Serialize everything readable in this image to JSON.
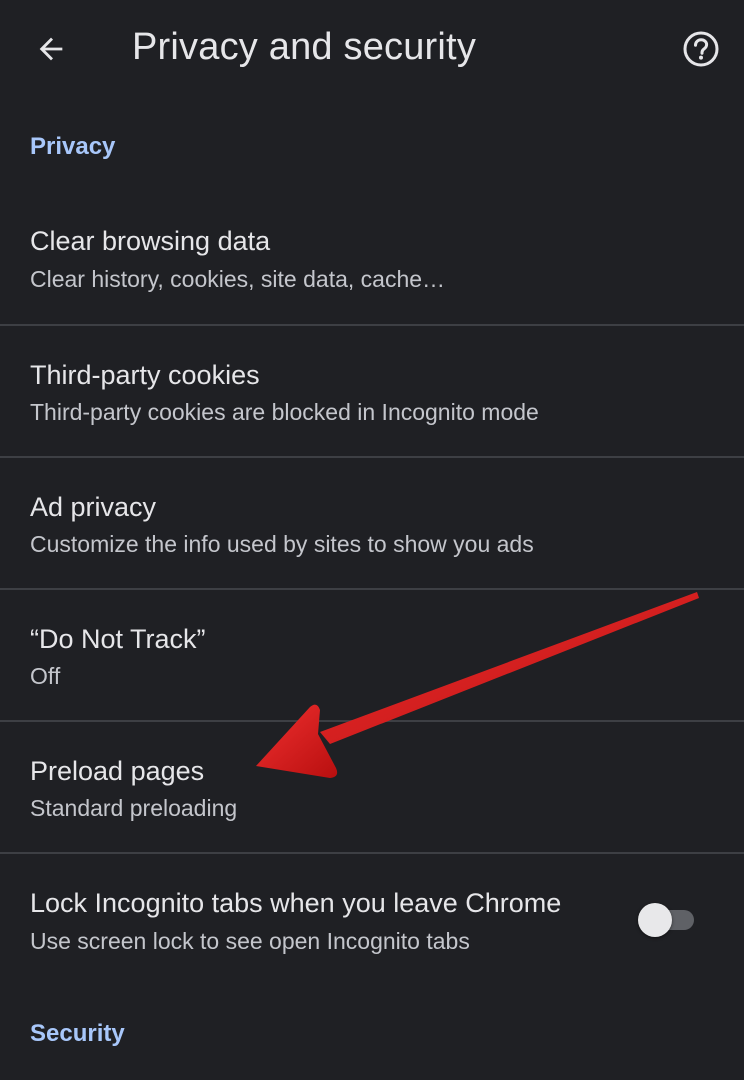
{
  "toolbar": {
    "title": "Privacy and security",
    "back_icon": "arrow-back-icon",
    "help_icon": "help-circle-icon"
  },
  "sections": {
    "privacy_label": "Privacy",
    "security_label": "Security"
  },
  "rows": [
    {
      "title": "Clear browsing data",
      "subtitle": "Clear history, cookies, site data, cache…"
    },
    {
      "title": "Third-party cookies",
      "subtitle": "Third-party cookies are blocked in Incognito mode"
    },
    {
      "title": "Ad privacy",
      "subtitle": "Customize the info used by sites to show you ads"
    },
    {
      "title": "“Do Not Track”",
      "subtitle": "Off"
    },
    {
      "title": "Preload pages",
      "subtitle": "Standard preloading"
    },
    {
      "title": "Lock Incognito tabs when you leave Chrome",
      "subtitle": "Use screen lock to see open Incognito tabs",
      "toggle_on": false
    }
  ],
  "colors": {
    "background": "#1f2024",
    "accent": "#a8c7fa",
    "annotation_arrow": "#d81818"
  }
}
